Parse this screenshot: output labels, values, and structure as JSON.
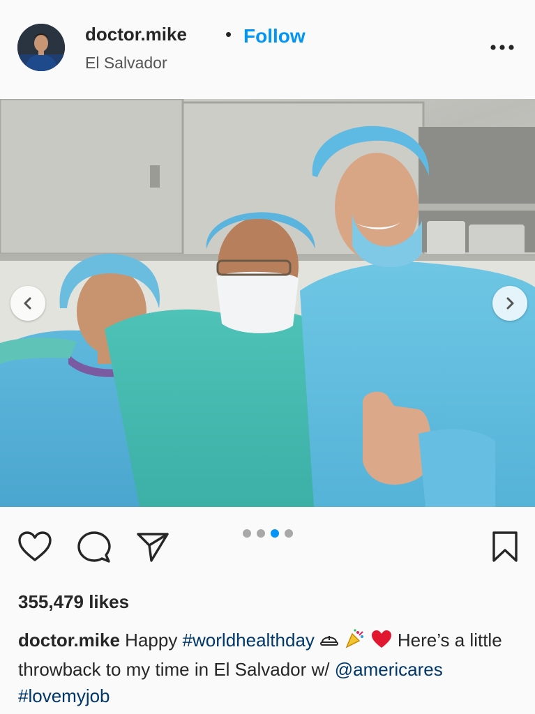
{
  "header": {
    "username": "doctor.mike",
    "separator": "•",
    "follow_label": "Follow",
    "location": "El Salvador"
  },
  "icons": {
    "avatar": "profile-photo",
    "more": "more-dots-icon",
    "prev": "chevron-left-icon",
    "next": "chevron-right-icon",
    "like": "heart-icon",
    "comment": "comment-icon",
    "share": "paper-plane-icon",
    "save": "bookmark-icon"
  },
  "carousel": {
    "total": 4,
    "active_index": 3
  },
  "colors": {
    "accent": "#0095f6",
    "hashtag": "#00376b",
    "text": "#262626"
  },
  "likes": "355,479 likes",
  "caption": {
    "username": "doctor.mike",
    "text_1": "Happy",
    "hashtag_1": "#worldhealthday",
    "text_2": "Here’s a little throwback to my time in El Salvador w/",
    "mention": "@americares",
    "hashtag_2": "#lovemyjob"
  }
}
